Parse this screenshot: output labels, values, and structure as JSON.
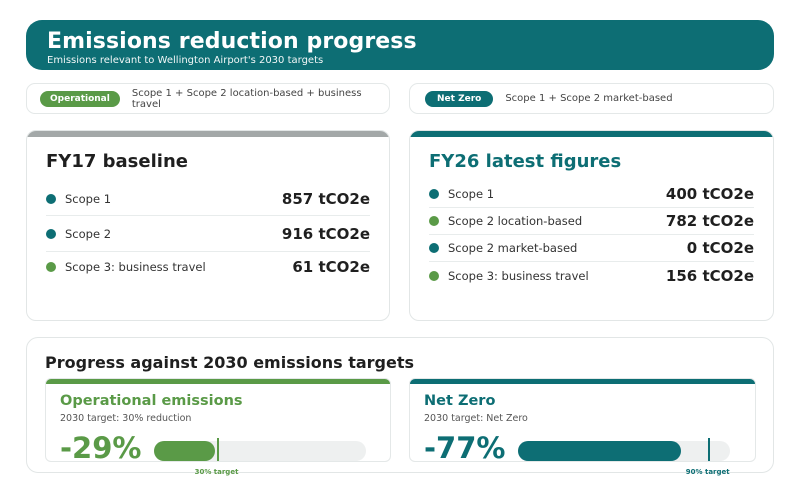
{
  "colors": {
    "teal": "#0d6e74",
    "green": "#5a9a47",
    "grey": "#a3a8a8"
  },
  "header": {
    "title": "Emissions reduction progress",
    "subtitle": "Emissions relevant to Wellington Airport's 2030 targets"
  },
  "legend": [
    {
      "badge": "Operational",
      "text": "Scope 1 + Scope 2 location-based + business travel"
    },
    {
      "badge": "Net Zero",
      "text": "Scope 1 + Scope 2 market-based"
    }
  ],
  "baseline": {
    "title": "FY17 baseline",
    "rows": [
      {
        "label": "Scope 1",
        "value": "857 tCO2e",
        "dot": "teal"
      },
      {
        "label": "Scope 2",
        "value": "916 tCO2e",
        "dot": "teal"
      },
      {
        "label": "Scope 3: business travel",
        "value": "61 tCO2e",
        "dot": "green"
      }
    ]
  },
  "latest": {
    "title": "FY26 latest figures",
    "rows": [
      {
        "label": "Scope 1",
        "value": "400 tCO2e",
        "dot": "teal"
      },
      {
        "label": "Scope 2 location-based",
        "value": "782 tCO2e",
        "dot": "green"
      },
      {
        "label": "Scope 2 market-based",
        "value": "0 tCO2e",
        "dot": "teal"
      },
      {
        "label": "Scope 3: business travel",
        "value": "156 tCO2e",
        "dot": "green"
      }
    ]
  },
  "progress": {
    "title": "Progress against 2030 emissions targets",
    "operational": {
      "name": "Operational emissions",
      "target": "2030 target: 30% reduction",
      "pct": "-29%",
      "fill_percent": 29,
      "marker_percent": 30,
      "marker_label": "30% target"
    },
    "netzero": {
      "name": "Net Zero",
      "target": "2030 target: Net Zero",
      "pct": "-77%",
      "fill_percent": 77,
      "marker_percent": 90,
      "marker_label": "90% target"
    }
  }
}
